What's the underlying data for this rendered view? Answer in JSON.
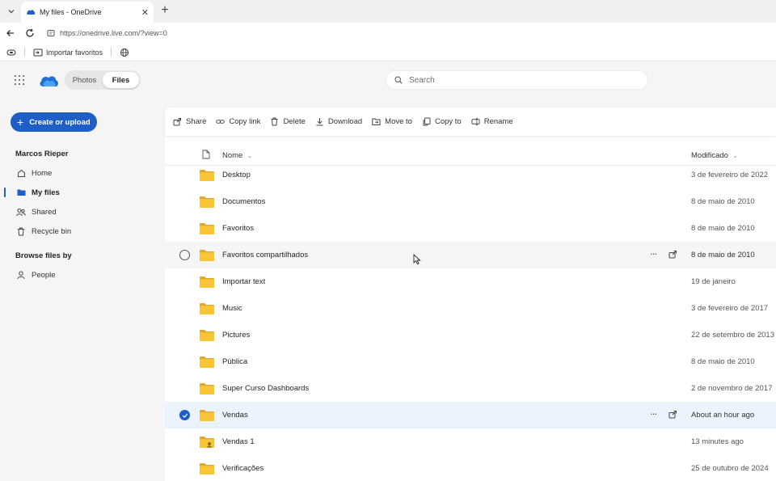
{
  "browser": {
    "tab_title": "My files - OneDrive",
    "url": "https://onedrive.live.com/?view=0",
    "bookmark_label": "Importar favoritos"
  },
  "header": {
    "segments": [
      "Photos",
      "Files"
    ],
    "active_segment": "Files",
    "search_placeholder": "Search"
  },
  "sidebar": {
    "create_label": "Create or upload",
    "user_name": "Marcos Rieper",
    "nav": [
      {
        "label": "Home",
        "icon": "home-icon",
        "active": false
      },
      {
        "label": "My files",
        "icon": "folder-icon",
        "active": true
      },
      {
        "label": "Shared",
        "icon": "people-icon",
        "active": false
      },
      {
        "label": "Recycle bin",
        "icon": "trash-icon",
        "active": false
      }
    ],
    "browse_heading": "Browse files by",
    "browse_items": [
      {
        "label": "People",
        "icon": "person-icon"
      }
    ]
  },
  "commands": [
    {
      "label": "Share",
      "icon": "share-icon"
    },
    {
      "label": "Copy link",
      "icon": "link-icon"
    },
    {
      "label": "Delete",
      "icon": "trash-icon"
    },
    {
      "label": "Download",
      "icon": "download-icon"
    },
    {
      "label": "Move to",
      "icon": "move-icon"
    },
    {
      "label": "Copy to",
      "icon": "copy-icon"
    },
    {
      "label": "Rename",
      "icon": "rename-icon"
    }
  ],
  "columns": {
    "name": "Nome",
    "modified": "Modificado"
  },
  "files": [
    {
      "name": "Desktop",
      "modified": "3 de fevereiro de 2022",
      "state": "normal"
    },
    {
      "name": "Documentos",
      "modified": "8 de maio de 2010",
      "state": "normal"
    },
    {
      "name": "Favoritos",
      "modified": "8 de maio de 2010",
      "state": "normal"
    },
    {
      "name": "Favoritos compartilhados",
      "modified": "8 de maio de 2010",
      "state": "hover"
    },
    {
      "name": "Importar text",
      "modified": "19 de janeiro",
      "state": "normal"
    },
    {
      "name": "Music",
      "modified": "3 de fevereiro de 2017",
      "state": "normal"
    },
    {
      "name": "Pictures",
      "modified": "22 de setembro de 2013",
      "state": "normal"
    },
    {
      "name": "Pública",
      "modified": "8 de maio de 2010",
      "state": "normal"
    },
    {
      "name": "Super Curso Dashboards",
      "modified": "2 de novembro de 2017",
      "state": "normal"
    },
    {
      "name": "Vendas",
      "modified": "About an hour ago",
      "state": "selected"
    },
    {
      "name": "Vendas 1",
      "modified": "13 minutes ago",
      "state": "normal",
      "shared": true
    },
    {
      "name": "Verificações",
      "modified": "25 de outubro de 2024",
      "state": "normal"
    }
  ],
  "colors": {
    "accent": "#1f5fc5",
    "folder": "#f8c537",
    "selected_row": "#ebf3fc"
  }
}
